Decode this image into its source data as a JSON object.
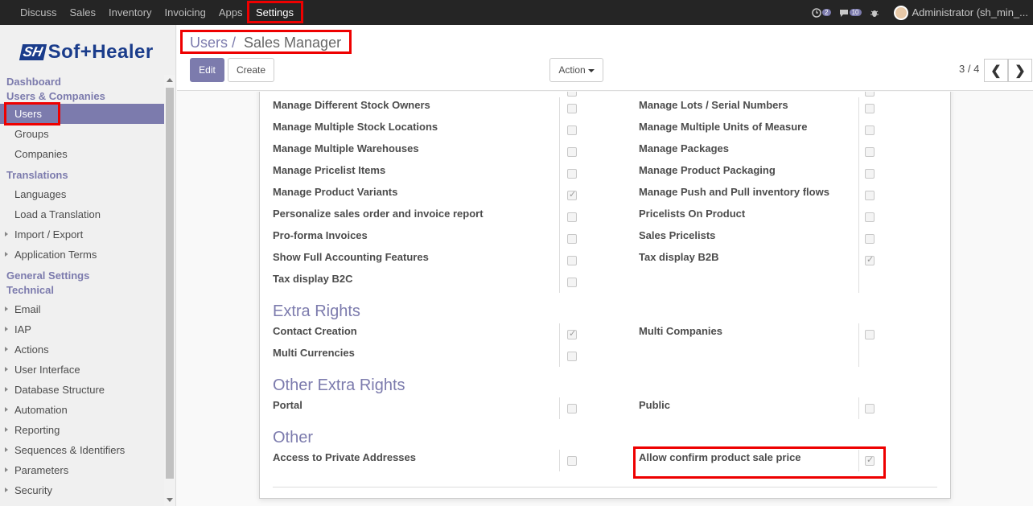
{
  "topbar": {
    "menu": [
      "Discuss",
      "Sales",
      "Inventory",
      "Invoicing",
      "Apps"
    ],
    "active_menu": "Settings",
    "activity_count": "2",
    "message_count": "10",
    "user": "Administrator (sh_min_..."
  },
  "sidebar": {
    "logo_mark": "SH",
    "logo_text": "Sof+Healer",
    "sections": {
      "dashboard": "Dashboard",
      "users_companies": "Users & Companies",
      "translations": "Translations",
      "general_settings": "General Settings",
      "technical": "Technical"
    },
    "users_items": [
      "Users",
      "Groups",
      "Companies"
    ],
    "translation_items": [
      "Languages",
      "Load a Translation",
      "Import / Export",
      "Application Terms"
    ],
    "technical_items": [
      "Email",
      "IAP",
      "Actions",
      "User Interface",
      "Database Structure",
      "Automation",
      "Reporting",
      "Sequences & Identifiers",
      "Parameters",
      "Security"
    ]
  },
  "control_panel": {
    "breadcrumb_parent": "Users /",
    "breadcrumb_current": "Sales Manager",
    "edit_label": "Edit",
    "create_label": "Create",
    "action_label": "Action",
    "pager": "3 / 4",
    "prev": "❮",
    "next": "❯"
  },
  "form": {
    "technical_rows": [
      {
        "left": "Manage Different Stock Owners",
        "left_checked": false,
        "right": "Manage Lots / Serial Numbers",
        "right_checked": false
      },
      {
        "left": "Manage Multiple Stock Locations",
        "left_checked": false,
        "right": "Manage Multiple Units of Measure",
        "right_checked": false
      },
      {
        "left": "Manage Multiple Warehouses",
        "left_checked": false,
        "right": "Manage Packages",
        "right_checked": false
      },
      {
        "left": "Manage Pricelist Items",
        "left_checked": false,
        "right": "Manage Product Packaging",
        "right_checked": false
      },
      {
        "left": "Manage Product Variants",
        "left_checked": true,
        "right": "Manage Push and Pull inventory flows",
        "right_checked": false
      },
      {
        "left": "Personalize sales order and invoice report",
        "left_checked": false,
        "right": "Pricelists On Product",
        "right_checked": false
      },
      {
        "left": "Pro-forma Invoices",
        "left_checked": false,
        "right": "Sales Pricelists",
        "right_checked": false
      },
      {
        "left": "Show Full Accounting Features",
        "left_checked": false,
        "right": "Tax display B2B",
        "right_checked": true
      },
      {
        "left": "Tax display B2C",
        "left_checked": false,
        "right": "",
        "right_checked": null
      }
    ],
    "extra_rights_title": "Extra Rights",
    "extra_rights": [
      {
        "left": "Contact Creation",
        "left_checked": true,
        "right": "Multi Companies",
        "right_checked": false
      },
      {
        "left": "Multi Currencies",
        "left_checked": false,
        "right": "",
        "right_checked": null
      }
    ],
    "other_extra_rights_title": "Other Extra Rights",
    "other_extra_rights": [
      {
        "left": "Portal",
        "left_checked": false,
        "right": "Public",
        "right_checked": false
      }
    ],
    "other_title": "Other",
    "other": [
      {
        "left": "Access to Private Addresses",
        "left_checked": false,
        "right": "Allow confirm product sale price",
        "right_checked": true
      }
    ]
  }
}
